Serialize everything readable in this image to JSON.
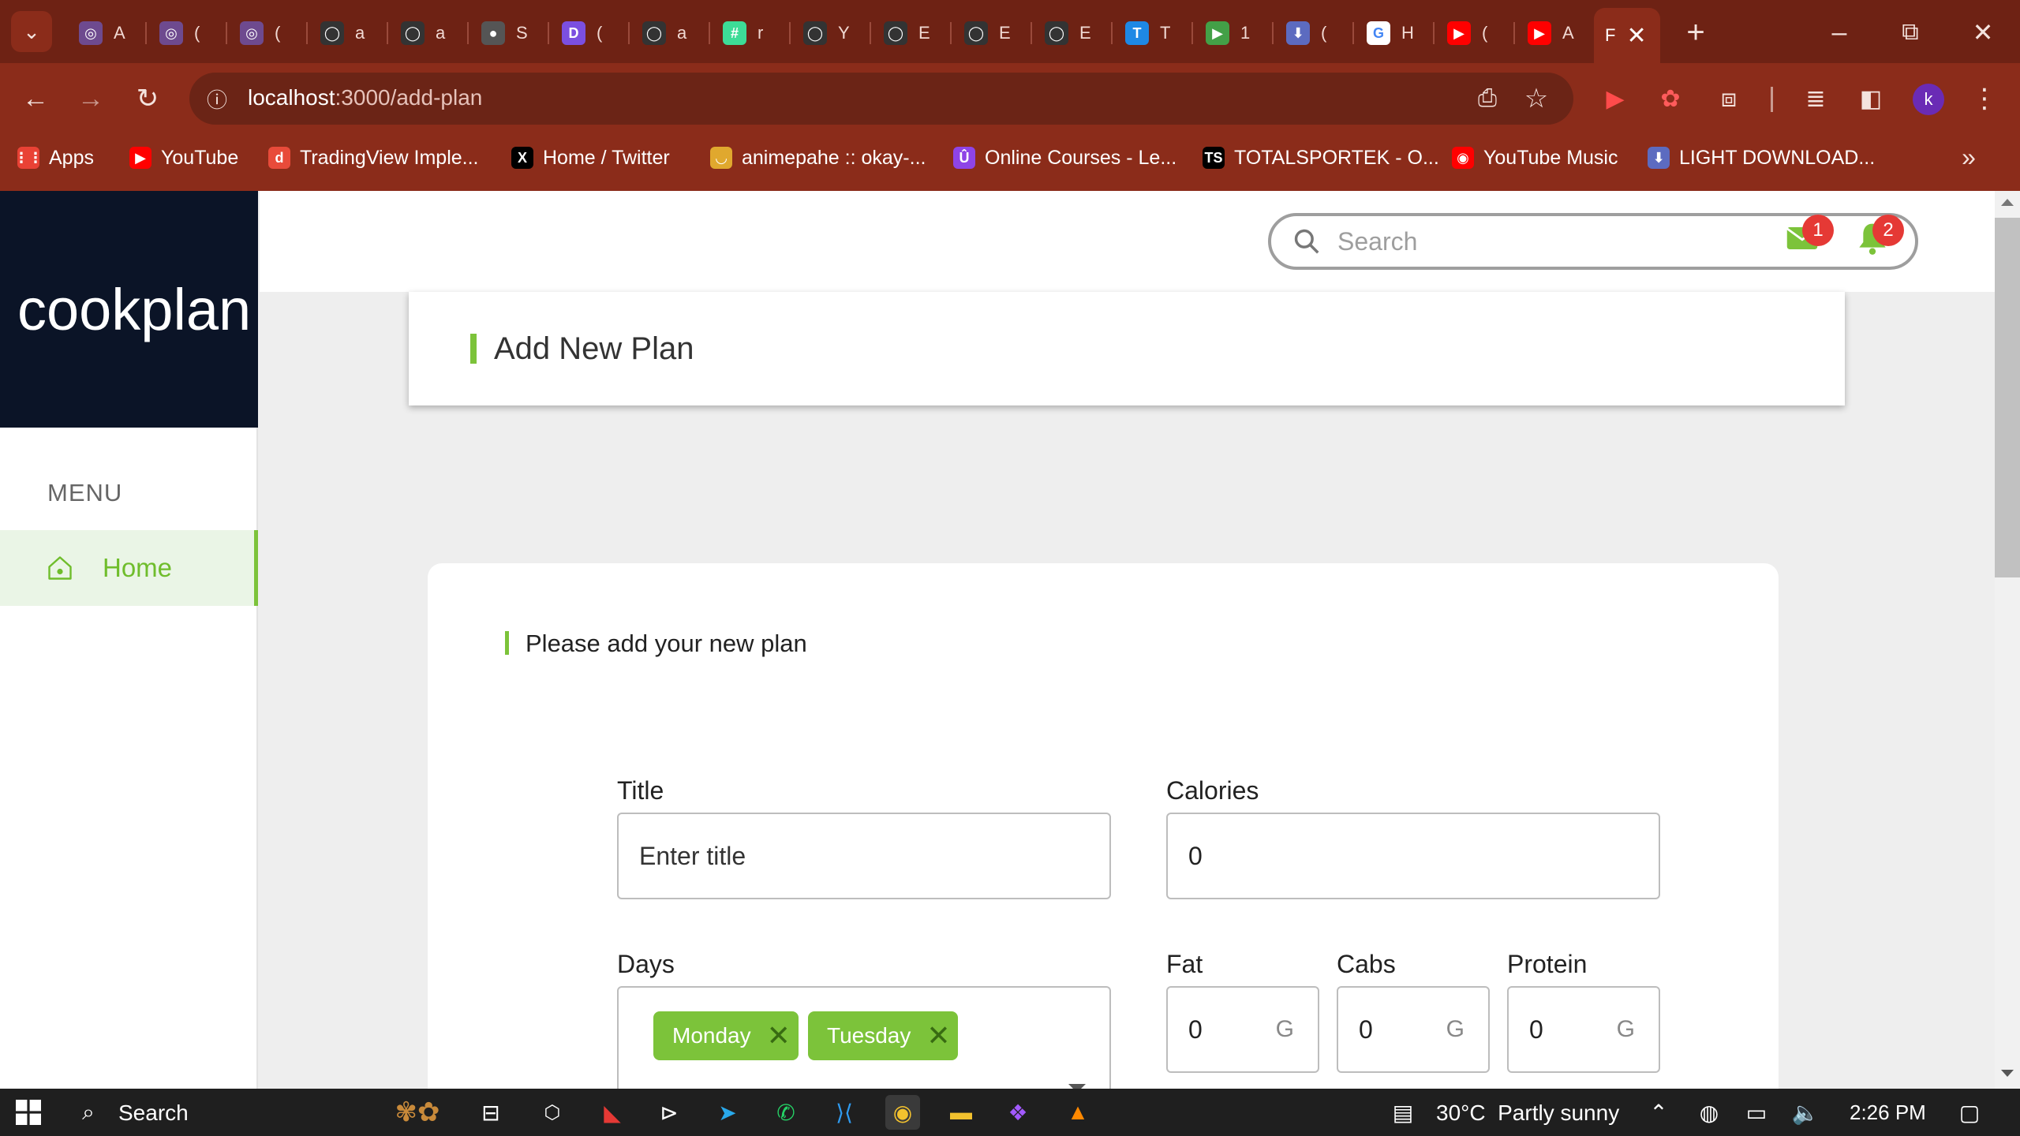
{
  "browser": {
    "tabs": [
      {
        "letter": "A",
        "color": "#6e4a8f",
        "glyph": "◎"
      },
      {
        "letter": "(",
        "color": "#6e4a8f",
        "glyph": "◎"
      },
      {
        "letter": "(",
        "color": "#6e4a8f",
        "glyph": "◎"
      },
      {
        "letter": "a",
        "color": "#333333",
        "glyph": "◯"
      },
      {
        "letter": "a",
        "color": "#333333",
        "glyph": "◯"
      },
      {
        "letter": "S",
        "color": "#555555",
        "glyph": "●"
      },
      {
        "letter": "(",
        "color": "#7b4fe0",
        "glyph": "D"
      },
      {
        "letter": "a",
        "color": "#333333",
        "glyph": "◯"
      },
      {
        "letter": "r",
        "color": "#3ddc97",
        "glyph": "#"
      },
      {
        "letter": "Y",
        "color": "#333333",
        "glyph": "◯"
      },
      {
        "letter": "E",
        "color": "#333333",
        "glyph": "◯"
      },
      {
        "letter": "E",
        "color": "#333333",
        "glyph": "◯"
      },
      {
        "letter": "E",
        "color": "#333333",
        "glyph": "◯"
      },
      {
        "letter": "T",
        "color": "#1e88e5",
        "glyph": "T"
      },
      {
        "letter": "1",
        "color": "#43a047",
        "glyph": "▶"
      },
      {
        "letter": "(",
        "color": "#5c6bc0",
        "glyph": "⬇"
      },
      {
        "letter": "H",
        "color": "#ffffff",
        "glyph": "G"
      },
      {
        "letter": "(",
        "color": "#ff0000",
        "glyph": "▶"
      },
      {
        "letter": "A",
        "color": "#ff0000",
        "glyph": "▶"
      }
    ],
    "active_tab_letter": "F",
    "url_host": "localhost",
    "url_rest": ":3000/add-plan",
    "profile_initial": "k",
    "bookmarks": [
      {
        "label": "Apps",
        "color": "#e94235",
        "glyph": "⋮⋮"
      },
      {
        "label": "YouTube",
        "color": "#ff0000",
        "glyph": "▶"
      },
      {
        "label": "TradingView Imple...",
        "color": "#e84b3a",
        "glyph": "d"
      },
      {
        "label": "Home / Twitter",
        "color": "#000000",
        "glyph": "X"
      },
      {
        "label": "animepahe :: okay-...",
        "color": "#e0a82e",
        "glyph": "◡"
      },
      {
        "label": "Online Courses - Le...",
        "color": "#8e44e6",
        "glyph": "Û"
      },
      {
        "label": "TOTALSPORTEK - O...",
        "color": "#000000",
        "glyph": "TS"
      },
      {
        "label": "YouTube Music",
        "color": "#ff0000",
        "glyph": "◉"
      },
      {
        "label": "LIGHT DOWNLOAD...",
        "color": "#5c6bc0",
        "glyph": "⬇"
      }
    ]
  },
  "app": {
    "brand": "cookplan",
    "menu_label": "MENU",
    "nav_home_label": "Home",
    "search_placeholder": "Search",
    "mail_badge": "1",
    "notification_badge": "2",
    "page_heading": "Add New Plan",
    "form_heading": "Please add your new plan",
    "form": {
      "title_label": "Title",
      "title_placeholder": "Enter title",
      "calories_label": "Calories",
      "calories_value": "0",
      "days_label": "Days",
      "days_chips": [
        "Monday",
        "Tuesday"
      ],
      "fat_label": "Fat",
      "fat_value": "0",
      "cabs_label": "Cabs",
      "cabs_value": "0",
      "protein_label": "Protein",
      "protein_value": "0",
      "unit": "G"
    },
    "accent_color": "#7cc33a"
  },
  "taskbar": {
    "search_label": "Search",
    "weather": "30°C  Partly sunny",
    "time": "2:26 PM"
  }
}
